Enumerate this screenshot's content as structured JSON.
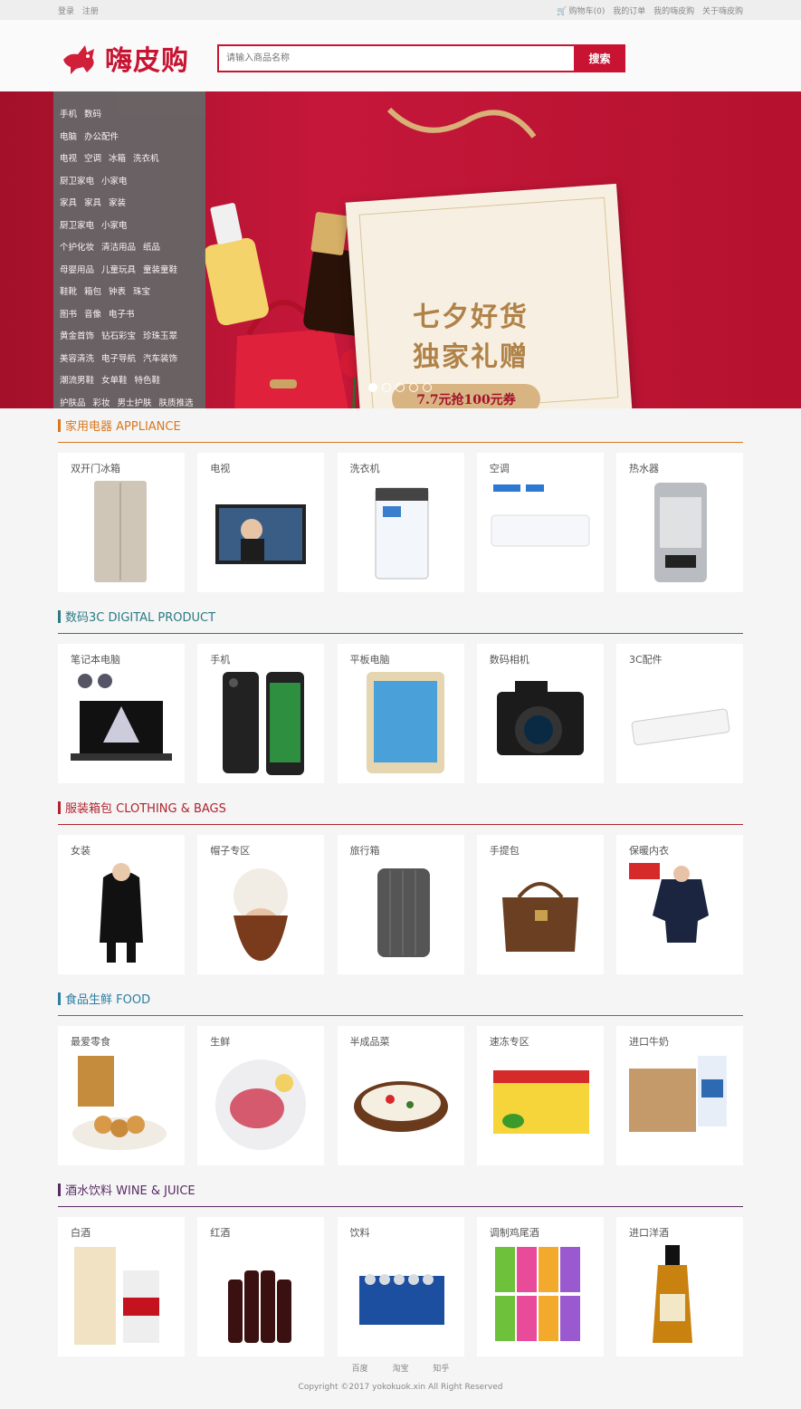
{
  "topbar": {
    "login": "登录",
    "register": "注册",
    "cart": "购物车(0)",
    "orders": "我的订单",
    "my": "我的嗨皮购",
    "about": "关于嗨皮购"
  },
  "header": {
    "logo_text": "嗨皮购",
    "search_placeholder": "请输入商品名称",
    "search_button": "搜索"
  },
  "menu": [
    [
      "手机",
      "数码"
    ],
    [
      "电脑",
      "办公配件"
    ],
    [
      "电视",
      "空调",
      "冰箱",
      "洗衣机"
    ],
    [
      "厨卫家电",
      "小家电"
    ],
    [
      "家具",
      "家具",
      "家装"
    ],
    [
      "厨卫家电",
      "小家电"
    ],
    [
      "个护化妆",
      "清洁用品",
      "纸品"
    ],
    [
      "母婴用品",
      "儿童玩具",
      "童装童鞋"
    ],
    [
      "鞋靴",
      "箱包",
      "钟表",
      "珠宝"
    ],
    [
      "图书",
      "音像",
      "电子书"
    ],
    [
      "黄金首饰",
      "钻石彩宝",
      "珍珠玉翠"
    ],
    [
      "美容清洗",
      "电子导航",
      "汽车装饰"
    ],
    [
      "潮流男鞋",
      "女单鞋",
      "特色鞋"
    ],
    [
      "护肤品",
      "彩妆",
      "男士护肤",
      "肤质推选"
    ]
  ],
  "banner": {
    "title_line1": "七夕好货",
    "title_line2": "独家礼赠",
    "coupon": "7.7元抢100元券",
    "dots": 5,
    "active_dot": 0
  },
  "sections": [
    {
      "title": "家用电器 APPLIANCE",
      "color": "#d9771e",
      "items": [
        "双开门冰箱",
        "电视",
        "洗衣机",
        "空调",
        "热水器"
      ]
    },
    {
      "title": "数码3C DIGITAL PRODUCT",
      "color": "#2a7b84",
      "items": [
        "笔记本电脑",
        "手机",
        "平板电脑",
        "数码相机",
        "3C配件"
      ]
    },
    {
      "title": "服装箱包 CLOTHING & BAGS",
      "color": "#b0242d",
      "items": [
        "女装",
        "帽子专区",
        "旅行箱",
        "手提包",
        "保暖内衣"
      ]
    },
    {
      "title": "食品生鲜 FOOD",
      "color": "#2c7ea3",
      "items": [
        "最爱零食",
        "生鲜",
        "半成品菜",
        "速冻专区",
        "进口牛奶"
      ]
    },
    {
      "title": "酒水饮料 WINE & JUICE",
      "color": "#5a2a64",
      "items": [
        "白酒",
        "红酒",
        "饮料",
        "调制鸡尾酒",
        "进口洋酒"
      ]
    }
  ],
  "footer": {
    "links": [
      "百度",
      "淘宝",
      "知乎"
    ],
    "copyright": "Copyright ©2017 yokokuok.xin All Right Reserved"
  }
}
